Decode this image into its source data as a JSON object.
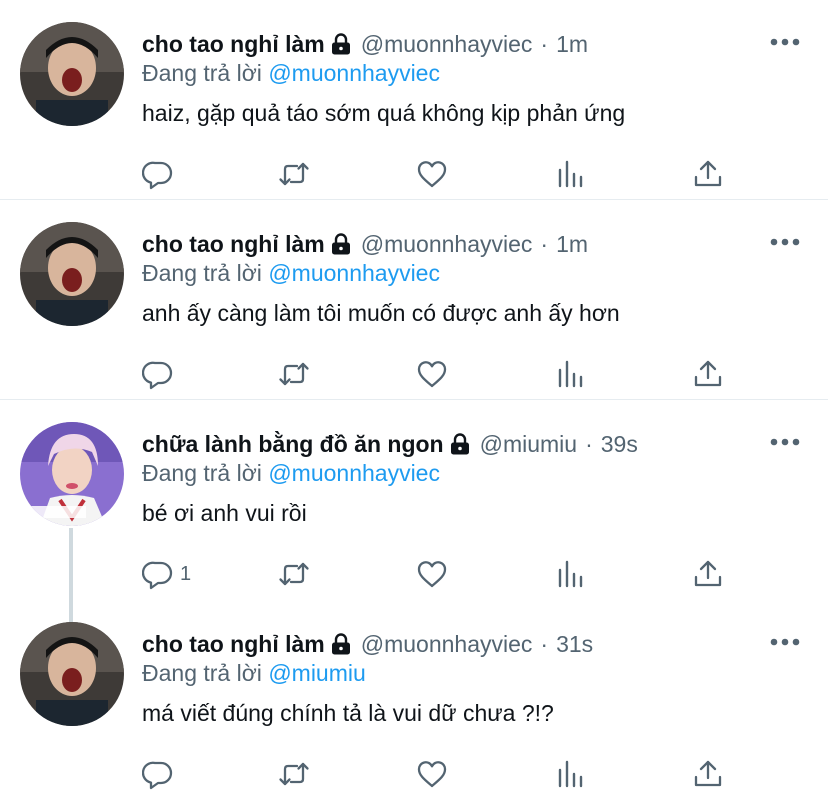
{
  "tweets": [
    {
      "display_name": "cho tao nghỉ làm",
      "handle": "@muonnhayviec",
      "dot": "·",
      "time": "1m",
      "reply_prefix": "Đang trả lời",
      "reply_to": "@muonnhayviec",
      "text": "haiz, gặp quả táo sớm quá không kịp phản ứng",
      "reply_count": ""
    },
    {
      "display_name": "cho tao nghỉ làm",
      "handle": "@muonnhayviec",
      "dot": "·",
      "time": "1m",
      "reply_prefix": "Đang trả lời",
      "reply_to": "@muonnhayviec",
      "text": "anh ấy càng làm tôi muốn có được anh ấy hơn",
      "reply_count": ""
    },
    {
      "display_name": "chữa lành bằng đồ ăn ngon",
      "handle": "@miumiu",
      "dot": "·",
      "time": "39s",
      "reply_prefix": "Đang trả lời",
      "reply_to": "@muonnhayviec",
      "text": "bé ơi anh vui rồi",
      "reply_count": "1"
    },
    {
      "display_name": "cho tao nghỉ làm",
      "handle": "@muonnhayviec",
      "dot": "·",
      "time": "31s",
      "reply_prefix": "Đang trả lời",
      "reply_to": "@miumiu",
      "text": "má viết đúng chính tả là vui dữ chưa ?!?",
      "reply_count": ""
    }
  ],
  "icons": {
    "more": "more-horizontal-icon",
    "lock": "lock-icon",
    "reply": "reply-bubble-icon",
    "retweet": "retweet-icon",
    "like": "heart-icon",
    "analytics": "analytics-bars-icon",
    "share": "share-upload-icon"
  },
  "colors": {
    "text": "#0f1419",
    "secondary": "#536471",
    "accent": "#1d9bf0",
    "divider": "#e6ecf0"
  }
}
